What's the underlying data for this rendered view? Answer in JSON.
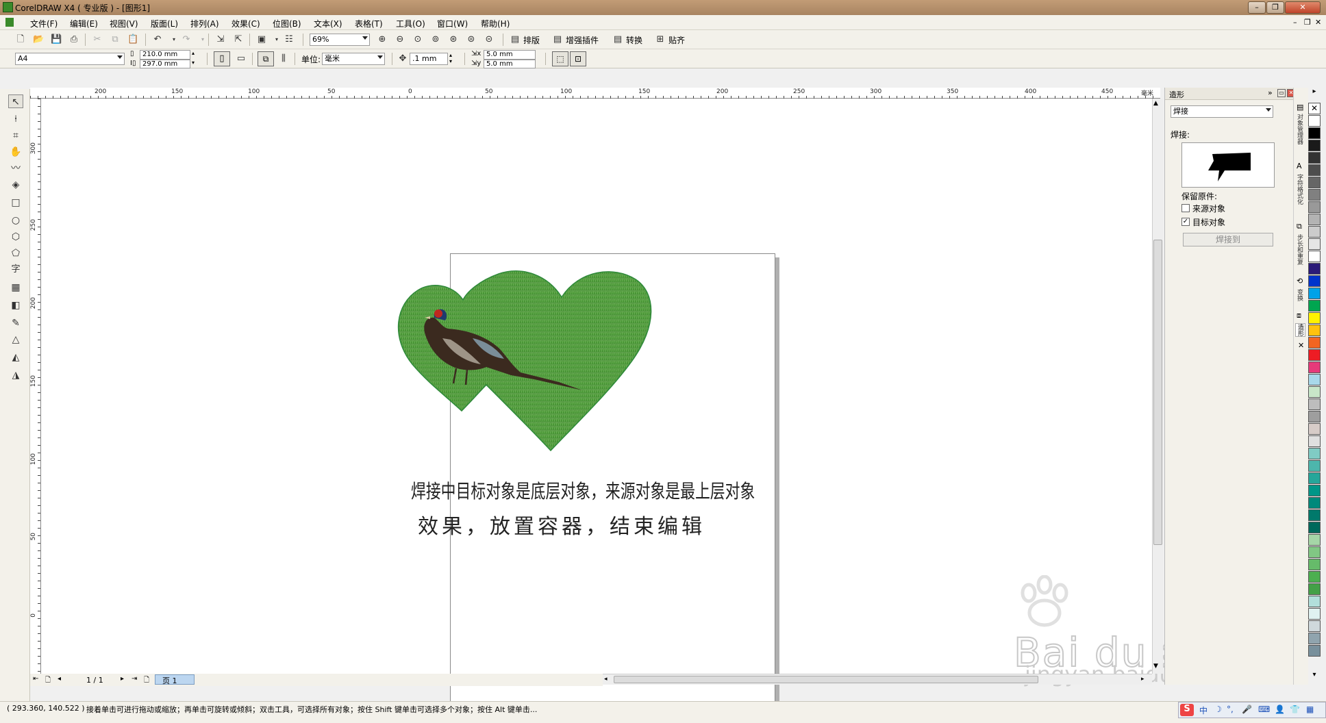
{
  "window": {
    "title": "CorelDRAW X4 ( 专业版 ) - [图形1]"
  },
  "menu": [
    "文件(F)",
    "编辑(E)",
    "视图(V)",
    "版面(L)",
    "排列(A)",
    "效果(C)",
    "位图(B)",
    "文本(X)",
    "表格(T)",
    "工具(O)",
    "窗口(W)",
    "帮助(H)"
  ],
  "toolbar": {
    "zoom": "69%",
    "buttons": [
      "排版",
      "增强插件",
      "转换",
      "贴齐"
    ]
  },
  "property_bar": {
    "paper": "A4",
    "width": "210.0 mm",
    "height": "297.0 mm",
    "units_label": "单位:",
    "units_value": "毫米",
    "nudge": ".1 mm",
    "dup_x": "5.0 mm",
    "dup_y": "5.0 mm"
  },
  "ruler": {
    "h_ticks": [
      "200",
      "150",
      "100",
      "50",
      "0",
      "50",
      "100",
      "150",
      "200",
      "250",
      "300",
      "350",
      "400",
      "450",
      "毫米"
    ],
    "v_ticks": [
      "300",
      "250",
      "200",
      "150",
      "100",
      "50",
      "0"
    ]
  },
  "page_text": {
    "line1": "焊接中目标对象是底层对象，来源对象是最上层对象",
    "line2": "效果，放置容器，结束编辑"
  },
  "page_nav": {
    "count": "1 / 1",
    "tab": "页 1"
  },
  "docker": {
    "title": "造形",
    "mode": "焊接",
    "section": "焊接:",
    "keep_label": "保留原件:",
    "opt_source": "来源对象",
    "opt_target": "目标对象",
    "source_checked": false,
    "target_checked": true,
    "apply_button": "焊接到"
  },
  "docker_tabs": [
    "对象管理器",
    "字符格式化",
    "步长和重复",
    "变换",
    "造形"
  ],
  "palette": [
    "#ffffff",
    "#000000",
    "#1a1a1a",
    "#333333",
    "#4d4d4d",
    "#666666",
    "#808080",
    "#999999",
    "#b3b3b3",
    "#cccccc",
    "#e6e6e6",
    "#ffffff",
    "#2b1a78",
    "#0033cc",
    "#00a2e8",
    "#00a650",
    "#fff200",
    "#ffc20e",
    "#f26522",
    "#ed1c24",
    "#e63a7a",
    "#a8d8ea",
    "#c8e6c9",
    "#bdbdbd",
    "#9e9e9e",
    "#d7ccc8",
    "#e0e0e0",
    "#80cbc4",
    "#4db6ac",
    "#26a69a",
    "#009688",
    "#00897b",
    "#00796b",
    "#00695c",
    "#a5d6a7",
    "#81c784",
    "#66bb6a",
    "#4caf50",
    "#43a047",
    "#b2dfdb",
    "#e0f2f1",
    "#cfd8dc",
    "#90a4ae",
    "#78909c"
  ],
  "status": {
    "coords": "( 293.360, 140.522 )",
    "hint": "接着单击可进行拖动或缩放；再单击可旋转或倾斜；双击工具，可选择所有对象；按住 Shift 键单击可选择多个对象；按住 Alt 键单击..."
  },
  "watermark": {
    "brand": "Bai du 经验",
    "url": "jingyan.baidu.com"
  }
}
